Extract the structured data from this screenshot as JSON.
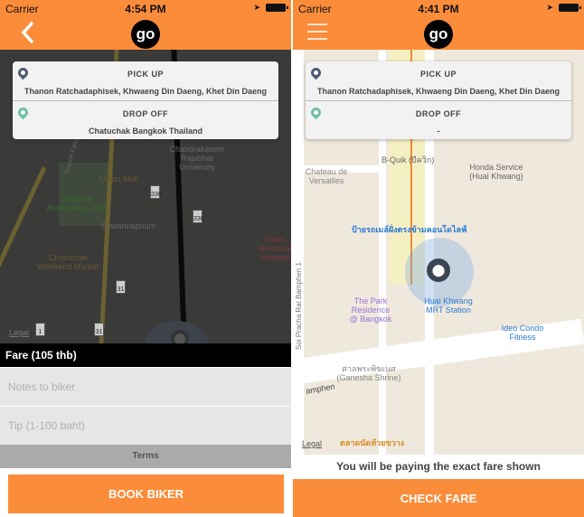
{
  "left": {
    "status": {
      "carrier": "Carrier",
      "time": "4:54 PM"
    },
    "logo": "go",
    "nav_icon": "back-chevron-icon",
    "card": {
      "pickup_label": "PICK UP",
      "pickup_value": "Thanon Ratchadaphisek, Khwaeng Din Daeng, Khet Din Daeng",
      "dropoff_label": "DROP OFF",
      "dropoff_value": "Chatuchak Bangkok Thailand"
    },
    "map_labels": {
      "park": "Wachira Benchathat Park",
      "union_mall": "Union Mall",
      "suwannaphum": "Suwannaphum",
      "market": "Chatuchak Weekend Market",
      "university": "Chandrakasem Rajabhat University",
      "hospital": "Paolo Memorial Hospital Chokchai",
      "road": "Thanon Kamphaeng Phet",
      "shield_336": "336",
      "shield_31": "31",
      "shield_1": "1",
      "legal": "Legal"
    },
    "fare": "Fare (105 thb)",
    "notes_placeholder": "Notes to biker",
    "tip_placeholder": "Tip (1-100 baht)",
    "terms": "Terms",
    "book_button": "BOOK BIKER"
  },
  "right": {
    "status": {
      "carrier": "Carrier",
      "time": "4:41 PM"
    },
    "logo": "go",
    "nav_icon": "hamburger-menu-icon",
    "card": {
      "pickup_label": "PICK UP",
      "pickup_value": "Thanon Ratchadaphisek, Khwaeng Din Daeng, Khet Din Daeng",
      "dropoff_label": "DROP OFF",
      "dropoff_value": "-"
    },
    "map_labels": {
      "bquik": "B-Quik (บีควิก)",
      "chateau": "Chateau de Versailles",
      "honda": "Honda Service (Huai Khwang)",
      "bus_stop": "ป้ายรถเมล์ฝั่งตรงข้ามคอนโดไลฟ์",
      "park_residence": "The Park Residence @ Bangkok",
      "mrt": "Huai Khwang MRT Station",
      "ideo": "Ideo Condo Fitness",
      "ganesha": "ศาลพระพิฆเนศ (Ganesha Shrine)",
      "street": "amphen",
      "street_vertical": "Soi Pracha Rat Bamphen 1",
      "market": "ตลาดนัดห้วยขวาง",
      "legal": "Legal"
    },
    "notice": "You will be paying the exact fare shown",
    "check_button": "CHECK FARE"
  },
  "colors": {
    "brand": "#fb8c3a",
    "pickup_pin": "#4e5a75",
    "dropoff_pin": "#6fbfa8"
  }
}
